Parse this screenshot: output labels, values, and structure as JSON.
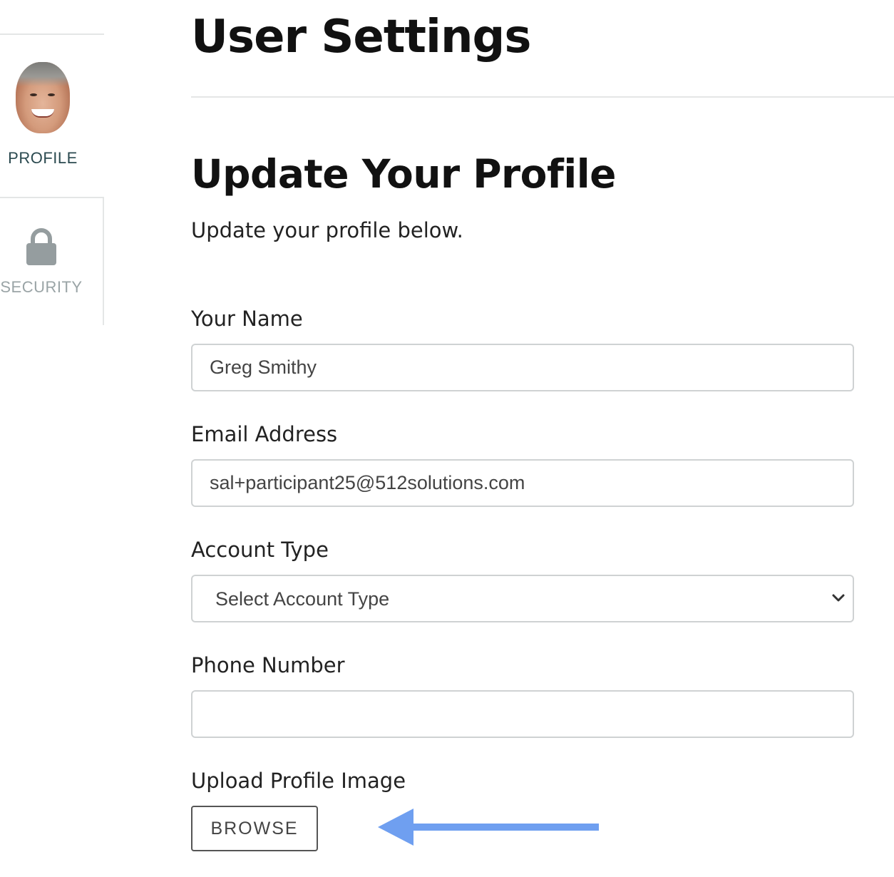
{
  "page": {
    "title": "User Settings"
  },
  "sidebar": {
    "items": [
      {
        "label": "PROFILE",
        "icon": "avatar",
        "active": true
      },
      {
        "label": "SECURITY",
        "icon": "lock-icon",
        "active": false
      }
    ]
  },
  "profile_form": {
    "title": "Update Your Profile",
    "subtitle": "Update your profile below.",
    "name": {
      "label": "Your Name",
      "value": "Greg Smithy"
    },
    "email": {
      "label": "Email Address",
      "value": "sal+participant25@512solutions.com"
    },
    "account_type": {
      "label": "Account Type",
      "selected": "Select Account Type"
    },
    "phone": {
      "label": "Phone Number",
      "value": ""
    },
    "upload": {
      "label": "Upload Profile Image",
      "button_label": "BROWSE"
    }
  },
  "colors": {
    "annotation_arrow": "#6f9ff0",
    "active_nav": "#2b4a50",
    "inactive_nav": "#9aa4a6",
    "border": "#cfd2d3"
  }
}
